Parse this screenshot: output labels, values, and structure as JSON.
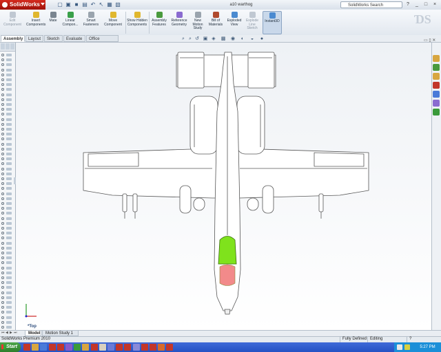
{
  "app": {
    "name": "SolidWorks",
    "document_title": "a10 warthog"
  },
  "search": {
    "placeholder": "SolidWorks Search"
  },
  "window_controls": [
    "?",
    "_",
    "□",
    "×"
  ],
  "quick_access": [
    {
      "icon": "new-doc-icon",
      "glyph": "▢"
    },
    {
      "icon": "open-icon",
      "glyph": "▣"
    },
    {
      "icon": "save-icon",
      "glyph": "■"
    },
    {
      "icon": "print-icon",
      "glyph": "▤"
    },
    {
      "icon": "undo-icon",
      "glyph": "↶"
    },
    {
      "icon": "select-icon",
      "glyph": "↖"
    },
    {
      "icon": "rebuild-icon",
      "glyph": "▦"
    },
    {
      "icon": "options-icon",
      "glyph": "▧"
    }
  ],
  "command_manager": [
    {
      "label": "Edit Component",
      "icon": "edit-component-icon",
      "state": "disabled",
      "color": "#c0c8d2"
    },
    {
      "label": "Insert Components",
      "icon": "insert-components-icon",
      "state": "enabled",
      "color": "#e0b72e"
    },
    {
      "label": "Mate",
      "icon": "mate-icon",
      "state": "enabled",
      "color": "#7a8590"
    },
    {
      "label": "Linear Compon...",
      "icon": "linear-pattern-icon",
      "state": "enabled",
      "color": "#3aa04a"
    },
    {
      "label": "Smart Fasteners",
      "icon": "smart-fasteners-icon",
      "state": "enabled",
      "color": "#9aa4ae"
    },
    {
      "label": "Move Component",
      "icon": "move-component-icon",
      "state": "enabled",
      "color": "#e0b72e"
    },
    {
      "label": "Show Hidden Components",
      "icon": "show-hidden-icon",
      "state": "enabled",
      "color": "#e0b72e"
    },
    {
      "label": "Assembly Features",
      "icon": "assembly-features-icon",
      "state": "enabled",
      "color": "#4a9a3e"
    },
    {
      "label": "Reference Geometry",
      "icon": "reference-geometry-icon",
      "state": "enabled",
      "color": "#8a6bd0"
    },
    {
      "label": "New Motion Study",
      "icon": "motion-study-icon",
      "state": "enabled",
      "color": "#9aa4ae"
    },
    {
      "label": "Bill of Materials",
      "icon": "bom-icon",
      "state": "enabled",
      "color": "#b04a2e"
    },
    {
      "label": "Exploded View",
      "icon": "exploded-view-icon",
      "state": "enabled",
      "color": "#4a8ad0"
    },
    {
      "label": "Explode Line Sketch",
      "icon": "explode-line-icon",
      "state": "disabled",
      "color": "#c0c8d2"
    },
    {
      "label": "Instant3D",
      "icon": "instant3d-icon",
      "state": "active",
      "color": "#4a8ad0"
    }
  ],
  "tabs": [
    "Assembly",
    "Layout",
    "Sketch",
    "Evaluate",
    "Office Products"
  ],
  "active_tab": "Assembly",
  "view_label": "*Top",
  "model_tabs": [
    "Model",
    "Motion Study 1"
  ],
  "active_model_tab": "Model",
  "status": {
    "product": "SolidWorks Premium 2010",
    "definition": "Fully Defined",
    "mode": "Editing Assembly",
    "help": "?"
  },
  "taskbar": {
    "start_label": "Start",
    "clock": "5:27 PM",
    "colors": [
      "#c2362a",
      "#d8a640",
      "#4a7ad8",
      "#c2362a",
      "#c2362a",
      "#8a5ac8",
      "#3a9a3a",
      "#d8a640",
      "#c2362a",
      "#d8d0c0",
      "#6a7ad8",
      "#c2362a",
      "#c2362a",
      "#8a8ad8",
      "#c2362a",
      "#c2362a",
      "#d86a2a",
      "#c2362a"
    ]
  },
  "task_pane_colors": [
    "#d8a640",
    "#4a9a3e",
    "#d8a640",
    "#c2362a",
    "#4a7ad8",
    "#8a6bd0",
    "#3a9a3a"
  ],
  "model": {
    "name": "a10 warthog",
    "canopy_color": "#7fe21c",
    "cockpit_color": "#f28a8a",
    "body_color": "#ffffff"
  }
}
